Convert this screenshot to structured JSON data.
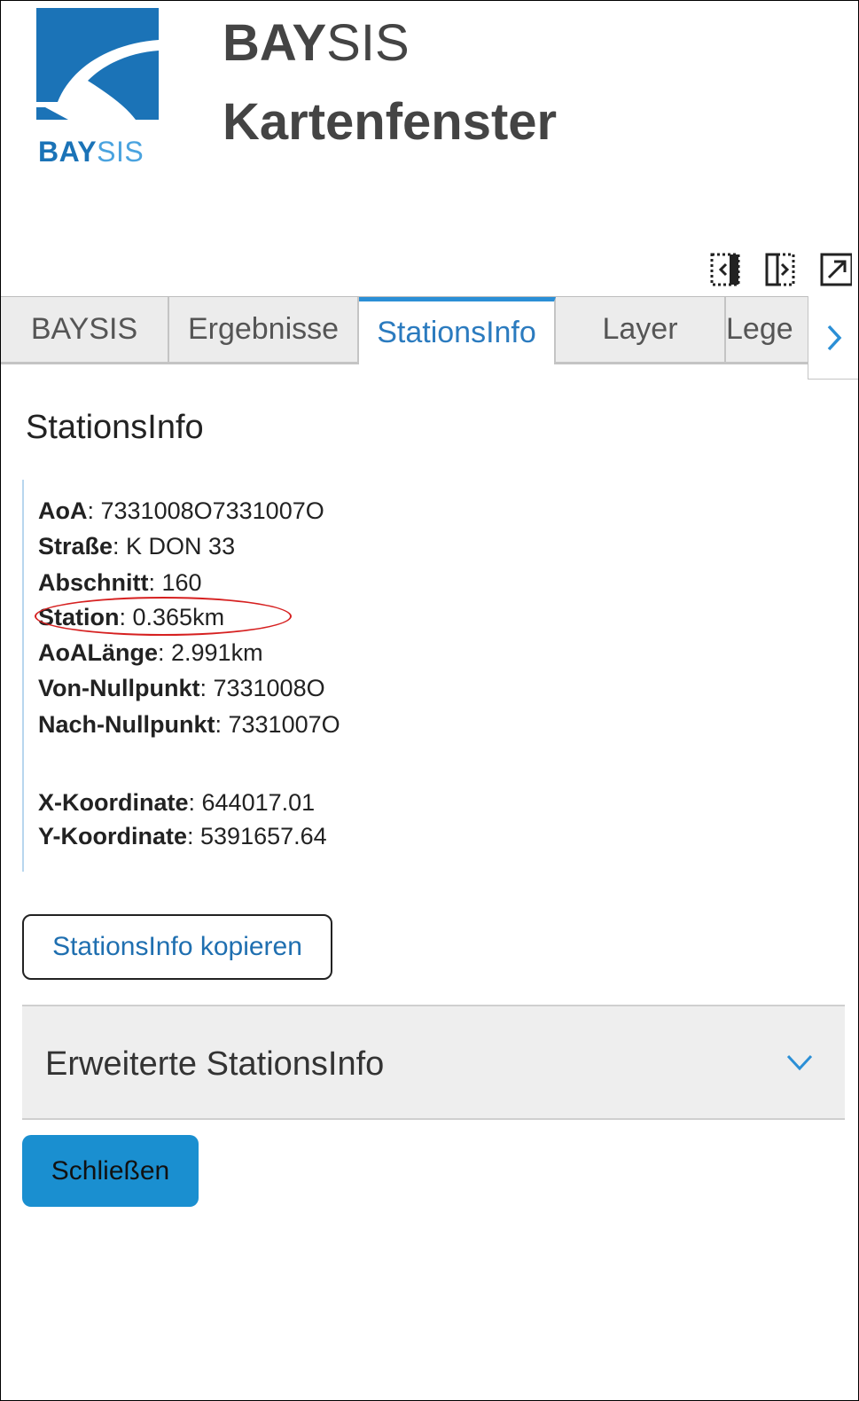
{
  "header": {
    "logo_text_bold": "BAY",
    "logo_text_thin": "SIS",
    "title_bold": "BAY",
    "title_thin": "SIS",
    "subtitle": "Kartenfenster"
  },
  "toolbar": {
    "icons": [
      "dock-left-icon",
      "dock-right-icon",
      "open-external-icon"
    ]
  },
  "tabs": [
    {
      "label": "BAYSIS",
      "active": false
    },
    {
      "label": "Ergebnisse",
      "active": false
    },
    {
      "label": "StationsInfo",
      "active": true
    },
    {
      "label": "Layer",
      "active": false
    },
    {
      "label": "Lege",
      "active": false
    }
  ],
  "panel": {
    "heading": "StationsInfo",
    "rows": [
      {
        "label": "AoA",
        "value": ": 7331008O7331007O"
      },
      {
        "label": "Straße",
        "value": ": K DON 33"
      },
      {
        "label": "Abschnitt",
        "value": ": 160"
      },
      {
        "label": "Station",
        "value": ": 0.365km"
      },
      {
        "label": "AoALänge",
        "value": ": 2.991km"
      },
      {
        "label": "Von-Nullpunkt",
        "value": ": 7331008O"
      },
      {
        "label": "Nach-Nullpunkt",
        "value": ": 7331007O"
      },
      {
        "label": "X-Koordinate",
        "value": ": 644017.01"
      },
      {
        "label": "Y-Koordinate",
        "value": ": 5391657.64"
      }
    ],
    "copy_button": "StationsInfo kopieren",
    "accordion_title": "Erweiterte StationsInfo",
    "close_button": "Schließen"
  },
  "colors": {
    "accent": "#1a8fd0",
    "tab_active_text": "#2b7bbf",
    "highlight": "#d62020",
    "logo_blue": "#1b73b7"
  }
}
